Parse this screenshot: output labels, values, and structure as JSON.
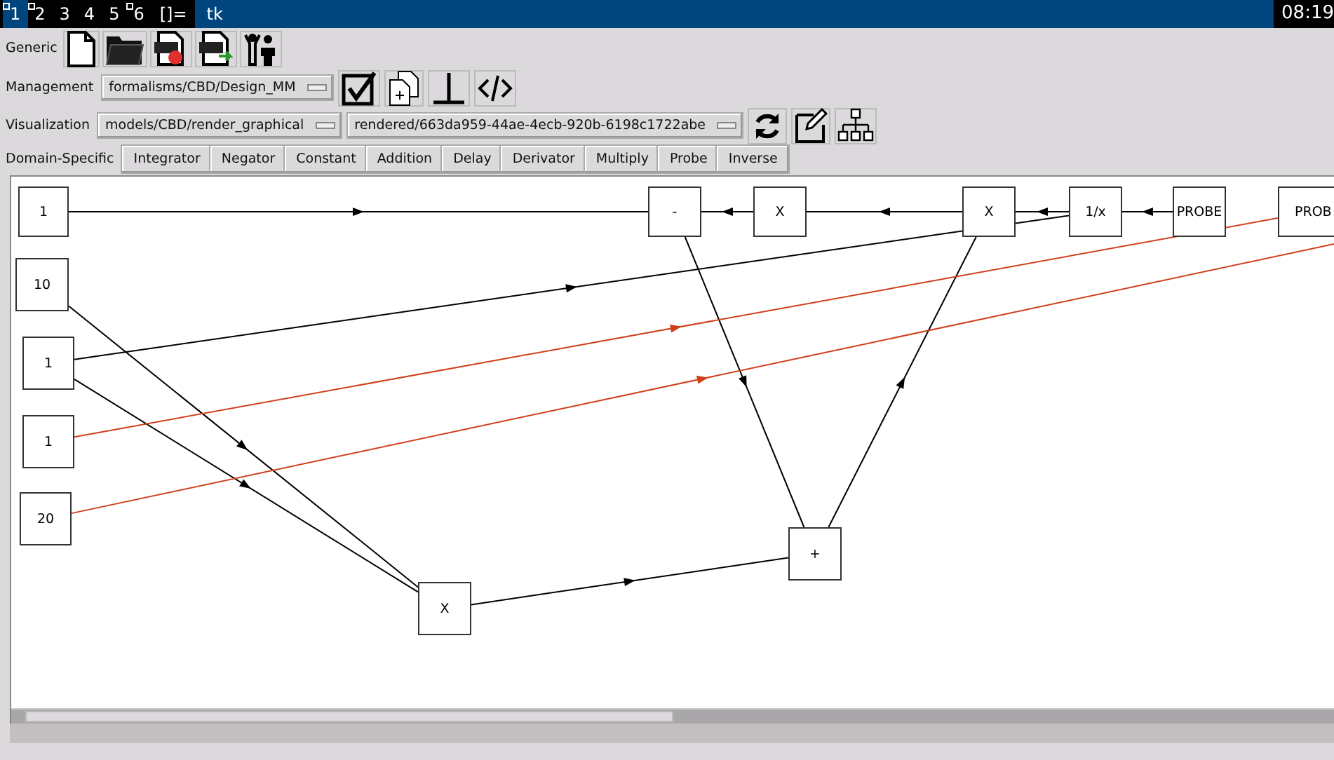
{
  "top_bar": {
    "workspaces": [
      {
        "label": "1",
        "selected": true,
        "occupied": true
      },
      {
        "label": "2",
        "selected": false,
        "occupied": true
      },
      {
        "label": "3",
        "selected": false,
        "occupied": false
      },
      {
        "label": "4",
        "selected": false,
        "occupied": false
      },
      {
        "label": "5",
        "selected": false,
        "occupied": false
      },
      {
        "label": "6",
        "selected": false,
        "occupied": true
      }
    ],
    "layout": "[]=",
    "window_title": "tk",
    "clock": "08:19"
  },
  "toolbars": {
    "generic": {
      "label": "Generic"
    },
    "management": {
      "label": "Management",
      "selector": "formalisms/CBD/Design_MM"
    },
    "visualization": {
      "label": "Visualization",
      "selectors": [
        "models/CBD/render_graphical",
        "rendered/663da959-44ae-4ecb-920b-6198c1722abe"
      ]
    },
    "domain_specific": {
      "label": "Domain-Specific",
      "buttons": [
        "Integrator",
        "Negator",
        "Constant",
        "Addition",
        "Delay",
        "Derivator",
        "Multiply",
        "Probe",
        "Inverse"
      ]
    }
  },
  "canvas": {
    "nodes": [
      {
        "label": "1"
      },
      {
        "label": "-"
      },
      {
        "label": "X"
      },
      {
        "label": "X"
      },
      {
        "label": "1/x"
      },
      {
        "label": "PROBE"
      },
      {
        "label": "PROB"
      },
      {
        "label": "10"
      },
      {
        "label": "1"
      },
      {
        "label": "1"
      },
      {
        "label": "20"
      },
      {
        "label": "X"
      },
      {
        "label": "+"
      }
    ],
    "edges": [
      {
        "color": "#000000"
      },
      {
        "color": "#000000"
      },
      {
        "color": "#000000"
      },
      {
        "color": "#000000"
      },
      {
        "color": "#000000"
      },
      {
        "color": "#000000"
      },
      {
        "color": "#000000"
      },
      {
        "color": "#000000"
      },
      {
        "color": "#000000"
      },
      {
        "color": "#000000"
      },
      {
        "color": "#000000"
      },
      {
        "color": "#d0401c"
      },
      {
        "color": "#d0401c"
      }
    ]
  }
}
